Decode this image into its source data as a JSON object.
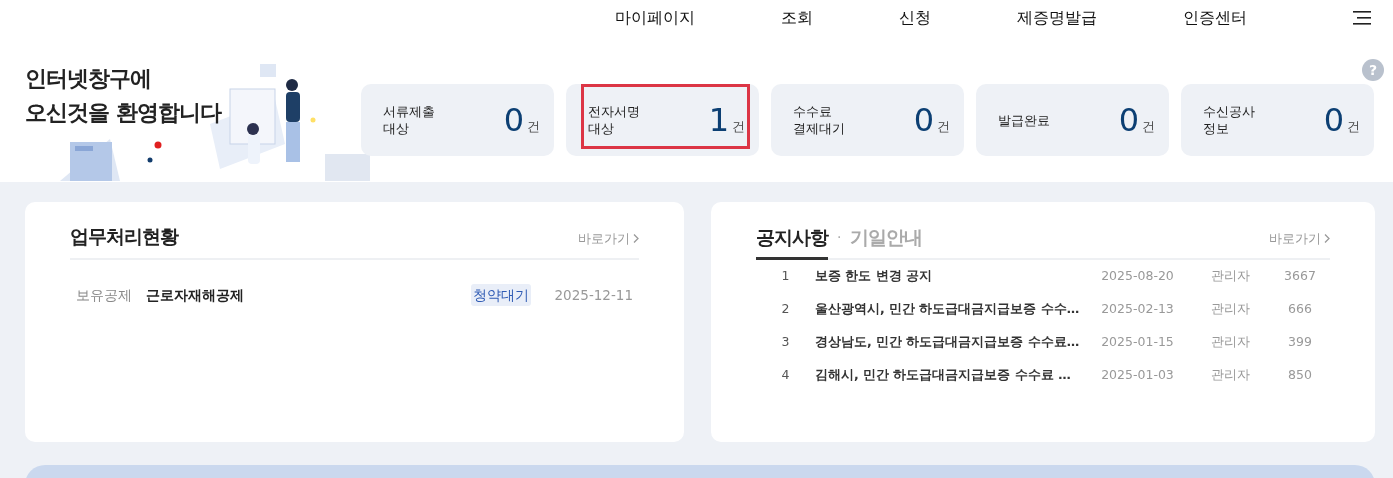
{
  "nav": {
    "items": [
      "마이페이지",
      "조회",
      "신청",
      "제증명발급",
      "인증센터"
    ]
  },
  "welcome": {
    "lines": [
      "인터넷창구에",
      "오신것을 환영합니다"
    ]
  },
  "stats": [
    {
      "label_lines": [
        "서류제출",
        "대상"
      ],
      "count": "0",
      "unit": "건",
      "highlighted": false
    },
    {
      "label_lines": [
        "전자서명",
        "대상"
      ],
      "count": "1",
      "unit": "건",
      "highlighted": true
    },
    {
      "label_lines": [
        "수수료",
        "결제대기"
      ],
      "count": "0",
      "unit": "건",
      "highlighted": false
    },
    {
      "label_lines": [
        "발급완료"
      ],
      "count": "0",
      "unit": "건",
      "highlighted": false
    },
    {
      "label_lines": [
        "수신공사",
        "정보"
      ],
      "count": "0",
      "unit": "건",
      "highlighted": false
    }
  ],
  "help": {
    "label": "?"
  },
  "work_panel": {
    "title": "업무처리현황",
    "more": "바로가기",
    "rows": [
      {
        "category": "보유공제",
        "name": "근로자재해공제",
        "status": "청약대기",
        "date": "2025-12-11"
      }
    ]
  },
  "notice_panel": {
    "tabs": [
      {
        "label": "공지사항",
        "selected": true
      },
      {
        "label": "기일안내",
        "selected": false
      }
    ],
    "tab_separator": "·",
    "more": "바로가기",
    "rows": [
      {
        "number": "1",
        "title": "보증 한도 변경 공지",
        "date": "2025-08-20",
        "author": "관리자",
        "views": "3667"
      },
      {
        "number": "2",
        "title": "울산광역시, 민간 하도급대금지급보증 수수…",
        "date": "2025-02-13",
        "author": "관리자",
        "views": "666"
      },
      {
        "number": "3",
        "title": "경상남도, 민간 하도급대금지급보증 수수료…",
        "date": "2025-01-15",
        "author": "관리자",
        "views": "399"
      },
      {
        "number": "4",
        "title": "김해시, 민간 하도급대금지급보증 수수료 …",
        "date": "2025-01-03",
        "author": "관리자",
        "views": "850"
      }
    ]
  }
}
